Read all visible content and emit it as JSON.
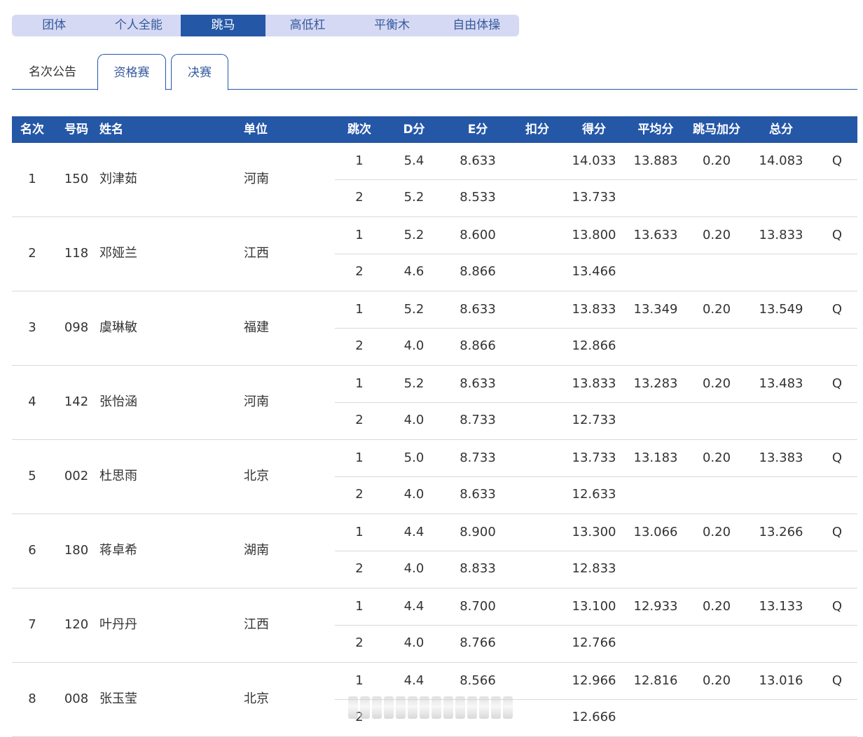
{
  "app_tabs": {
    "items": [
      "团体",
      "个人全能",
      "跳马",
      "高低杠",
      "平衡木",
      "自由体操"
    ],
    "active_index": 2
  },
  "sub_tabs": {
    "items": [
      "名次公告",
      "资格赛",
      "决赛"
    ],
    "active_index": 1
  },
  "table": {
    "headers": {
      "rank": "名次",
      "number": "号码",
      "name": "姓名",
      "unit": "单位",
      "vault": "跳次",
      "d": "D分",
      "e": "E分",
      "deduction": "扣分",
      "score": "得分",
      "average": "平均分",
      "bonus": "跳马加分",
      "total": "总分"
    },
    "rows": [
      {
        "rank": "1",
        "number": "150",
        "name": "刘津茹",
        "unit": "河南",
        "average": "13.883",
        "bonus": "0.20",
        "total": "14.083",
        "status": "Q",
        "vaults": [
          {
            "n": "1",
            "d": "5.4",
            "e": "8.633",
            "ded": "",
            "score": "14.033"
          },
          {
            "n": "2",
            "d": "5.2",
            "e": "8.533",
            "ded": "",
            "score": "13.733"
          }
        ]
      },
      {
        "rank": "2",
        "number": "118",
        "name": "邓娅兰",
        "unit": "江西",
        "average": "13.633",
        "bonus": "0.20",
        "total": "13.833",
        "status": "Q",
        "vaults": [
          {
            "n": "1",
            "d": "5.2",
            "e": "8.600",
            "ded": "",
            "score": "13.800"
          },
          {
            "n": "2",
            "d": "4.6",
            "e": "8.866",
            "ded": "",
            "score": "13.466"
          }
        ]
      },
      {
        "rank": "3",
        "number": "098",
        "name": "虞琳敏",
        "unit": "福建",
        "average": "13.349",
        "bonus": "0.20",
        "total": "13.549",
        "status": "Q",
        "vaults": [
          {
            "n": "1",
            "d": "5.2",
            "e": "8.633",
            "ded": "",
            "score": "13.833"
          },
          {
            "n": "2",
            "d": "4.0",
            "e": "8.866",
            "ded": "",
            "score": "12.866"
          }
        ]
      },
      {
        "rank": "4",
        "number": "142",
        "name": "张怡涵",
        "unit": "河南",
        "average": "13.283",
        "bonus": "0.20",
        "total": "13.483",
        "status": "Q",
        "vaults": [
          {
            "n": "1",
            "d": "5.2",
            "e": "8.633",
            "ded": "",
            "score": "13.833"
          },
          {
            "n": "2",
            "d": "4.0",
            "e": "8.733",
            "ded": "",
            "score": "12.733"
          }
        ]
      },
      {
        "rank": "5",
        "number": "002",
        "name": "杜思雨",
        "unit": "北京",
        "average": "13.183",
        "bonus": "0.20",
        "total": "13.383",
        "status": "Q",
        "vaults": [
          {
            "n": "1",
            "d": "5.0",
            "e": "8.733",
            "ded": "",
            "score": "13.733"
          },
          {
            "n": "2",
            "d": "4.0",
            "e": "8.633",
            "ded": "",
            "score": "12.633"
          }
        ]
      },
      {
        "rank": "6",
        "number": "180",
        "name": "蒋卓希",
        "unit": "湖南",
        "average": "13.066",
        "bonus": "0.20",
        "total": "13.266",
        "status": "Q",
        "vaults": [
          {
            "n": "1",
            "d": "4.4",
            "e": "8.900",
            "ded": "",
            "score": "13.300"
          },
          {
            "n": "2",
            "d": "4.0",
            "e": "8.833",
            "ded": "",
            "score": "12.833"
          }
        ]
      },
      {
        "rank": "7",
        "number": "120",
        "name": "叶丹丹",
        "unit": "江西",
        "average": "12.933",
        "bonus": "0.20",
        "total": "13.133",
        "status": "Q",
        "vaults": [
          {
            "n": "1",
            "d": "4.4",
            "e": "8.700",
            "ded": "",
            "score": "13.100"
          },
          {
            "n": "2",
            "d": "4.0",
            "e": "8.766",
            "ded": "",
            "score": "12.766"
          }
        ]
      },
      {
        "rank": "8",
        "number": "008",
        "name": "张玉莹",
        "unit": "北京",
        "average": "12.816",
        "bonus": "0.20",
        "total": "13.016",
        "status": "Q",
        "vaults": [
          {
            "n": "1",
            "d": "4.4",
            "e": "8.566",
            "ded": "",
            "score": "12.966"
          },
          {
            "n": "2",
            "d": "",
            "e": "",
            "ded": "",
            "score": "12.666"
          }
        ]
      }
    ]
  }
}
